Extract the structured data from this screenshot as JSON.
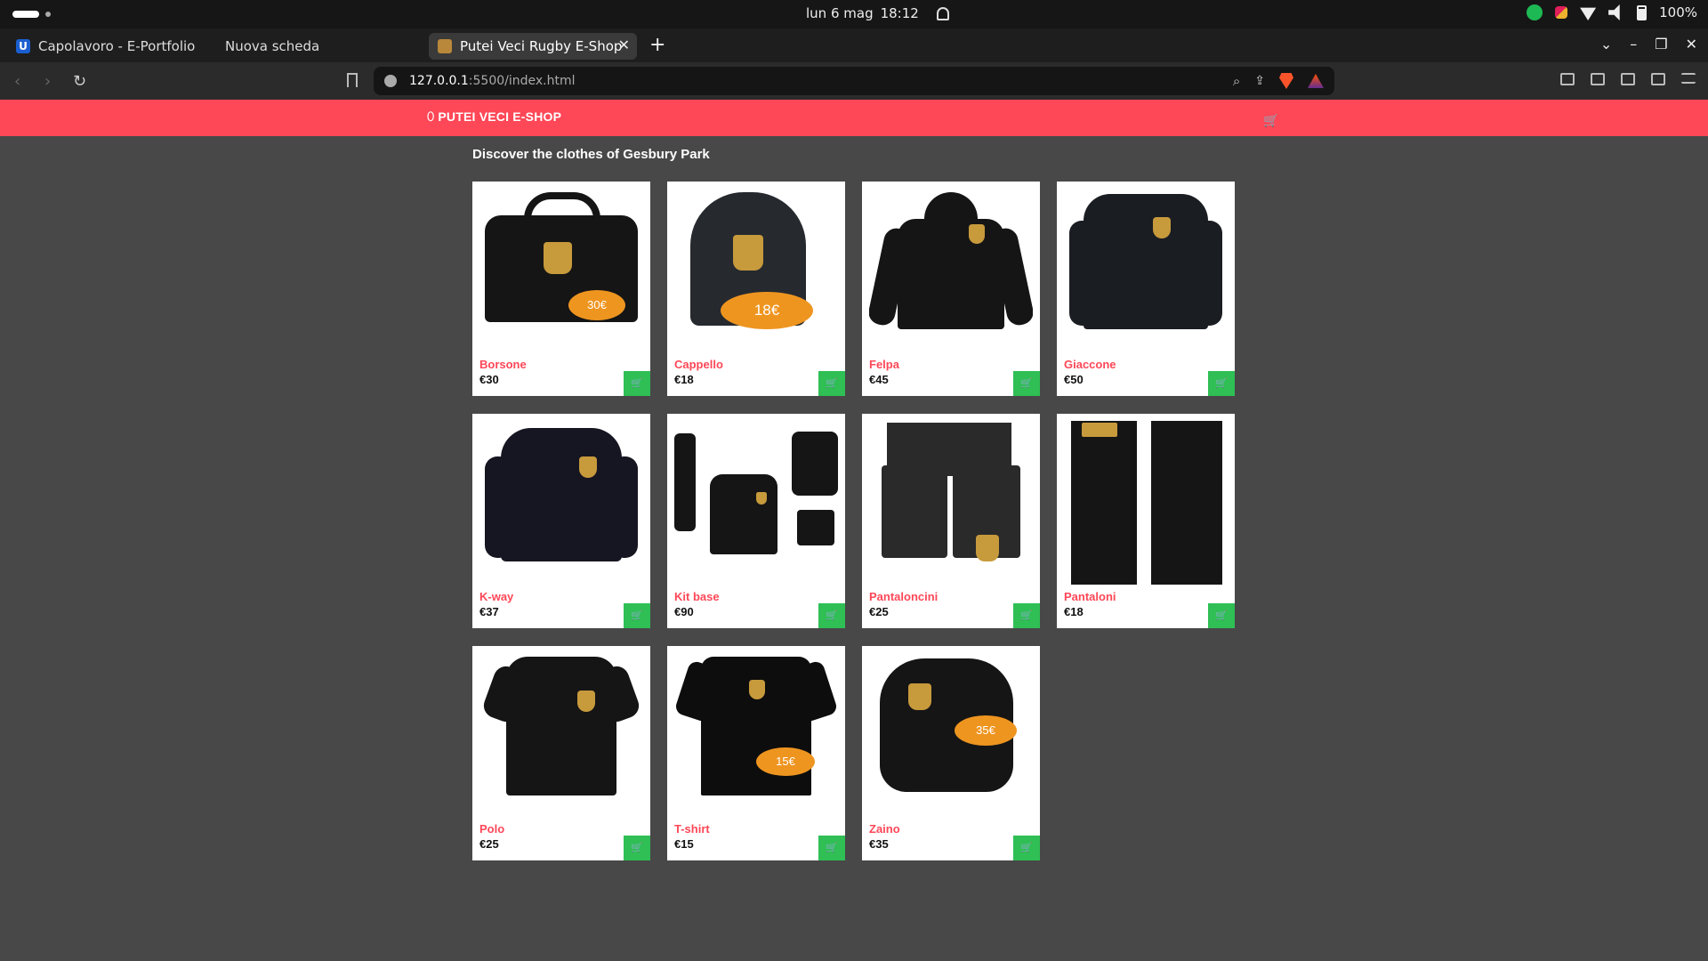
{
  "system": {
    "date": "lun 6 mag",
    "time": "18:12",
    "battery": "100%"
  },
  "browser": {
    "tabs": [
      {
        "label": "Capolavoro - E-Portfolio"
      },
      {
        "label": "Nuova scheda"
      },
      {
        "label": "Putei Veci Rugby E-Shop"
      }
    ],
    "url_host": "127.0.0.1",
    "url_path": ":5500/index.html"
  },
  "site": {
    "brand": "PUTEI VECI E-SHOP",
    "headline": "Discover the clothes of Gesbury Park",
    "products": [
      {
        "name": "Borsone",
        "price": "€30",
        "tag": "30€"
      },
      {
        "name": "Cappello",
        "price": "€18",
        "tag": "18€"
      },
      {
        "name": "Felpa",
        "price": "€45",
        "tag": ""
      },
      {
        "name": "Giaccone",
        "price": "€50",
        "tag": ""
      },
      {
        "name": "K-way",
        "price": "€37",
        "tag": ""
      },
      {
        "name": "Kit base",
        "price": "€90",
        "tag": ""
      },
      {
        "name": "Pantaloncini",
        "price": "€25",
        "tag": ""
      },
      {
        "name": "Pantaloni",
        "price": "€18",
        "tag": ""
      },
      {
        "name": "Polo",
        "price": "€25",
        "tag": ""
      },
      {
        "name": "T-shirt",
        "price": "€15",
        "tag": "15€"
      },
      {
        "name": "Zaino",
        "price": "€35",
        "tag": "35€"
      }
    ]
  },
  "colors": {
    "navbar": "#fe4757",
    "product_name": "#fe4757",
    "add_button": "#2fbf55",
    "price_tag": "#ee9520",
    "page_bg": "#484848"
  }
}
